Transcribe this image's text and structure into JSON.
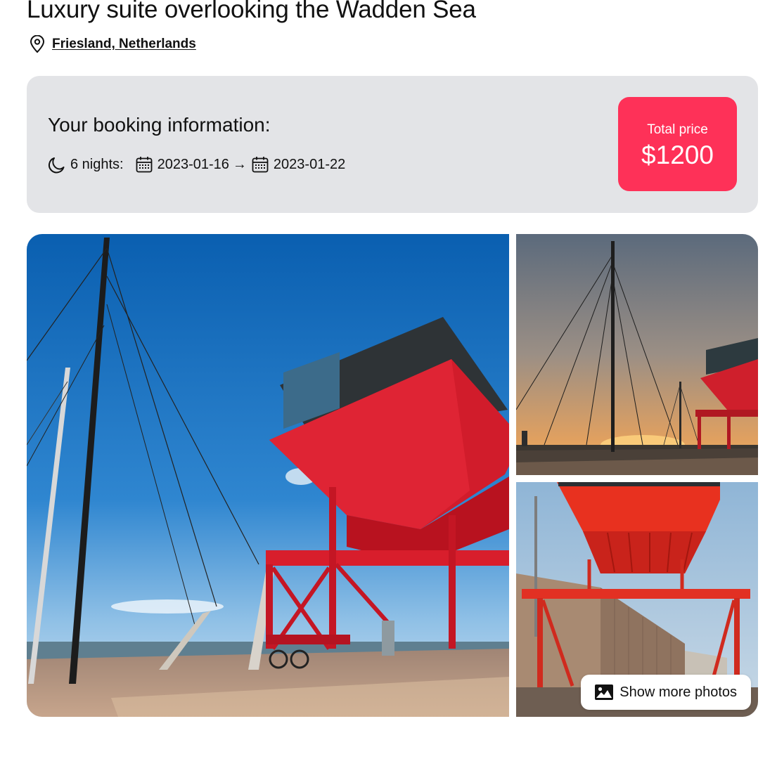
{
  "listing": {
    "title": "Luxury suite overlooking the Wadden Sea",
    "location": "Friesland, Netherlands"
  },
  "booking": {
    "heading": "Your booking information:",
    "nights": "6 nights:",
    "check_in": "2023-01-16",
    "arrow": "→",
    "check_out": "2023-01-22",
    "total_label": "Total price",
    "total_value": "$1200",
    "accent_color": "#fe3158"
  },
  "gallery": {
    "show_more_label": "Show more photos",
    "photos": [
      {
        "alt": "",
        "icon": "photo"
      },
      {
        "alt": "",
        "icon": "photo"
      },
      {
        "alt": "",
        "icon": "photo"
      }
    ]
  },
  "icons": {
    "location": "location-pin-icon",
    "nights": "moon-icon",
    "calendar": "calendar-icon",
    "photos": "image-icon"
  }
}
